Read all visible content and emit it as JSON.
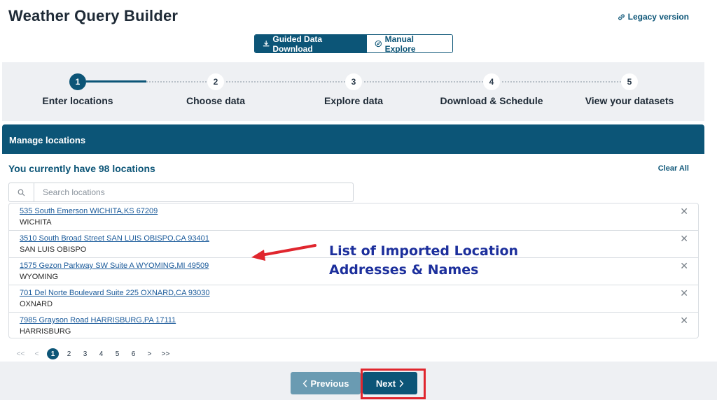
{
  "header": {
    "title": "Weather Query Builder",
    "legacy_link": "Legacy version"
  },
  "mode_toggle": {
    "guided_label": "Guided Data Download",
    "manual_label": "Manual Explore"
  },
  "stepper": {
    "steps": [
      {
        "number": "1",
        "label": "Enter locations"
      },
      {
        "number": "2",
        "label": "Choose data"
      },
      {
        "number": "3",
        "label": "Explore data"
      },
      {
        "number": "4",
        "label": "Download & Schedule"
      },
      {
        "number": "5",
        "label": "View your datasets"
      }
    ],
    "current_step": 1
  },
  "panel": {
    "title": "Manage locations",
    "count_text": "You currently have 98 locations",
    "clear_all": "Clear All",
    "search_placeholder": "Search locations"
  },
  "locations": [
    {
      "address": "535 South Emerson WICHITA,KS 67209",
      "name": "WICHITA"
    },
    {
      "address": "3510 South Broad Street SAN LUIS OBISPO,CA 93401",
      "name": "SAN LUIS OBISPO"
    },
    {
      "address": "1575 Gezon Parkway SW Suite A WYOMING,MI 49509",
      "name": "WYOMING"
    },
    {
      "address": "701 Del Norte Boulevard Suite 225 OXNARD,CA 93030",
      "name": "OXNARD"
    },
    {
      "address": "7985 Grayson Road HARRISBURG,PA 17111",
      "name": "HARRISBURG"
    }
  ],
  "annotation": {
    "line1": "List of Imported Location",
    "line2": "Addresses & Names",
    "color": "#1c2f9c",
    "arrow_color": "#e0262e"
  },
  "pagination": {
    "first": "<<",
    "prev": "<",
    "pages": [
      "1",
      "2",
      "3",
      "4",
      "5",
      "6"
    ],
    "current": "1",
    "next": ">",
    "last": ">>"
  },
  "footer": {
    "previous_label": "Previous",
    "next_label": "Next"
  },
  "colors": {
    "brand": "#0c5577",
    "highlight": "#e0262e",
    "link": "#1a5a9a"
  },
  "icons": {
    "legacy": "link-icon",
    "guided": "download-icon",
    "manual": "compass-icon",
    "search": "search-icon",
    "remove": "close-icon",
    "prev": "chevron-left-icon",
    "next": "chevron-right-icon"
  }
}
